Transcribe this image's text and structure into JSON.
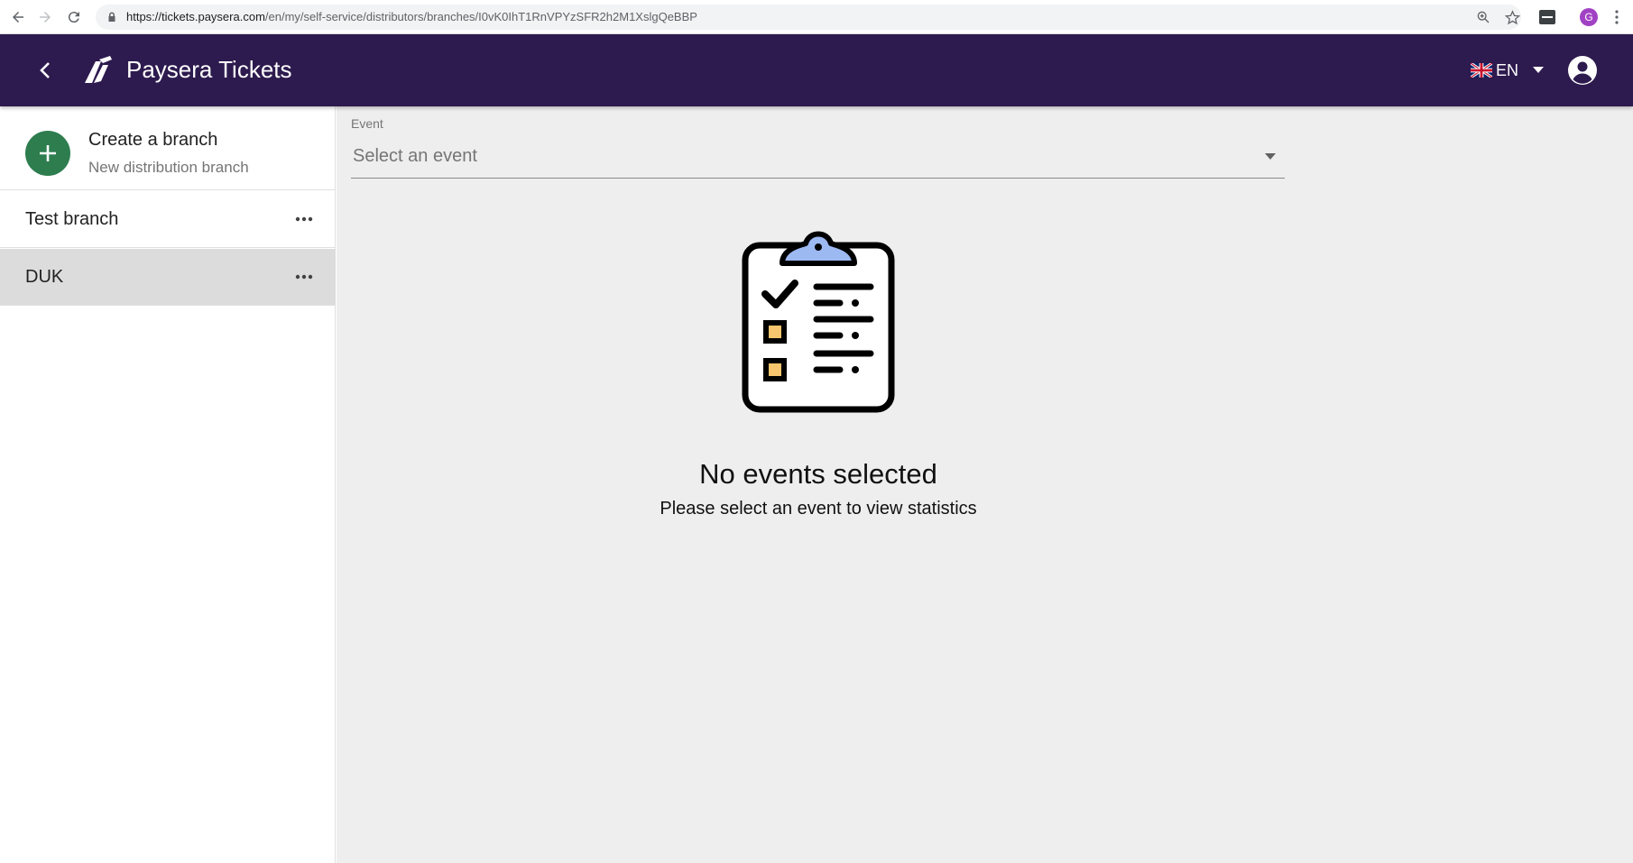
{
  "browser": {
    "url_host": "https://tickets.paysera.com",
    "url_path": "/en/my/self-service/distributors/branches/I0vK0IhT1RnVPYzSFR2h2M1XslgQeBBP",
    "profile_initial": "G"
  },
  "header": {
    "app_title": "Paysera Tickets",
    "language": "EN",
    "bg_color": "#2d1a4e"
  },
  "sidebar": {
    "create": {
      "title": "Create a branch",
      "subtitle": "New distribution branch",
      "icon": "plus-icon",
      "color": "#2e7d4f"
    },
    "branches": [
      {
        "label": "Test branch",
        "selected": false
      },
      {
        "label": "DUK",
        "selected": true
      }
    ]
  },
  "main": {
    "event_label": "Event",
    "event_placeholder": "Select an event",
    "empty_title": "No events selected",
    "empty_subtitle": "Please select an event to view statistics",
    "illustration": "clipboard-checklist-icon"
  }
}
